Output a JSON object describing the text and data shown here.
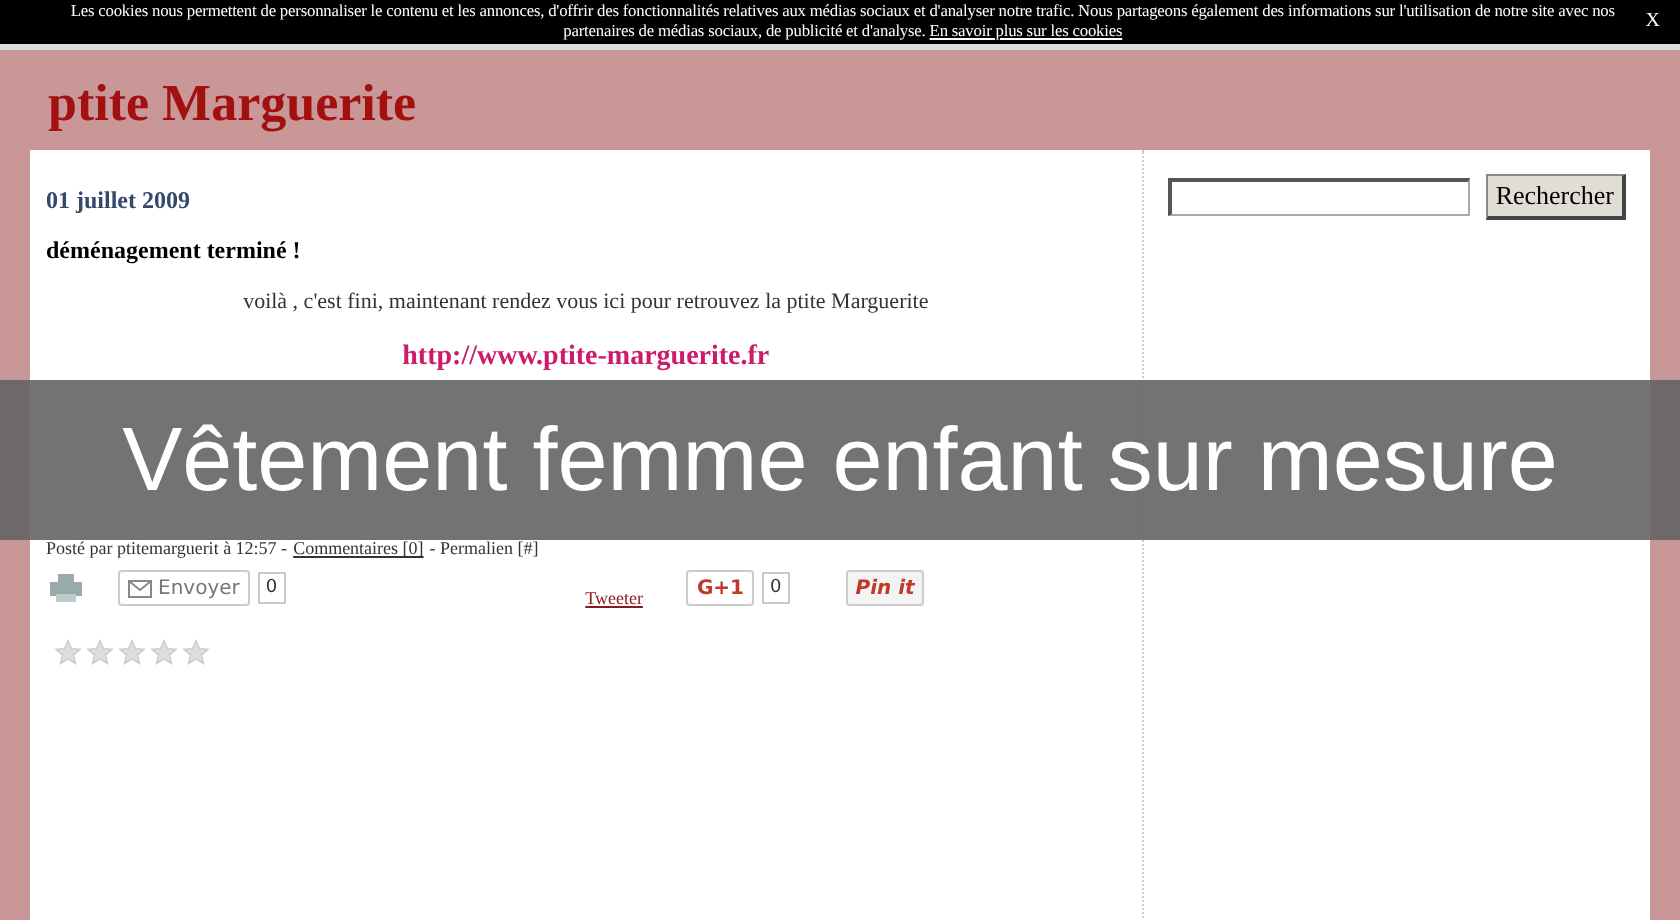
{
  "cookie_bar": {
    "text": "Les cookies nous permettent de personnaliser le contenu et les annonces, d'offrir des fonctionnalités relatives aux médias sociaux et d'analyser notre trafic. Nous partageons également des informations sur l'utilisation de notre site avec nos partenaires de médias sociaux, de publicité et d'analyse.",
    "link": "En savoir plus sur les cookies",
    "close": "X"
  },
  "blog_title": "ptite Marguerite",
  "post": {
    "date": "01 juillet 2009",
    "title": "déménagement terminé !",
    "body": "voilà , c'est fini, maintenant rendez vous ici pour retrouvez la ptite Marguerite",
    "link": "http://www.ptite-marguerite.fr",
    "footer": {
      "posted": "Posté par ptitemarguerit à 12:57 -",
      "comments": "Commentaires [0]",
      "permalink": "- Permalien [#]"
    },
    "share": {
      "email": "Envoyer",
      "email_count": "0",
      "tweet": "Tweeter",
      "gplus": "G+1",
      "gplus_count": "0",
      "pin": "Pin it"
    },
    "stars": 0
  },
  "sidebar": {
    "search": {
      "button": "Rechercher"
    }
  },
  "banner": "Vêtement femme enfant sur mesure"
}
